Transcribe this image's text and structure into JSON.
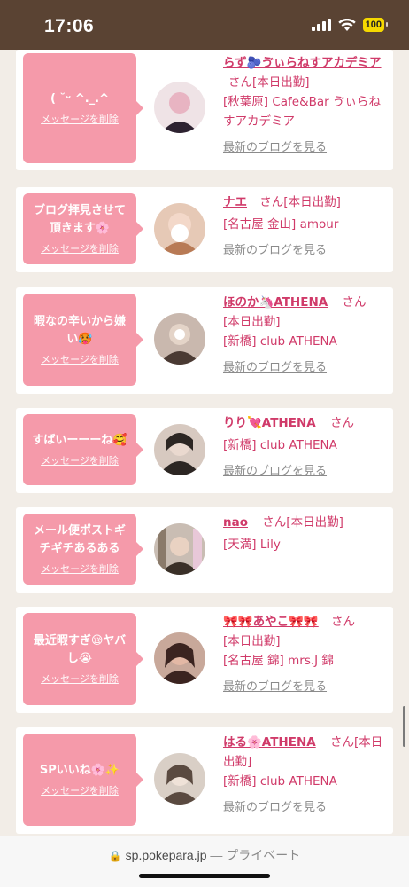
{
  "status_bar": {
    "time": "17:06",
    "battery": "100",
    "icons": [
      "signal-icon",
      "wifi-icon",
      "battery-icon"
    ]
  },
  "colors": {
    "header": "#5a4333",
    "bubble": "#f59aaa",
    "accent": "#d03a69",
    "link_gray": "#8b8b8b"
  },
  "messages": [
    {
      "bubble_text": "( ˘ᵕ ^._.^",
      "delete_label": "メッセージを削除",
      "name": "らず🫐ゔぃらねすアカデミア",
      "san": "さん",
      "today": "[本日出勤]",
      "shop": "[秋葉原] Cafe&Bar ゔぃらねすアカデミア",
      "blog_label": "最新のブログを見る",
      "avatar_colors": [
        "#e8b4c2",
        "#6b3a3a"
      ]
    },
    {
      "bubble_text": "ブログ拝見させて頂きます🌸",
      "delete_label": "メッセージを削除",
      "name": "ナエ",
      "san": "さん",
      "today": "[本日出勤]",
      "shop": "[名古屋 金山] amour",
      "blog_label": "最新のブログを見る",
      "avatar_colors": [
        "#f3d8c9",
        "#b87a55"
      ]
    },
    {
      "bubble_text": "暇なの辛いから嫌い🥵",
      "delete_label": "メッセージを削除",
      "name": "ほのか🦄ATHENA",
      "san": "さん",
      "today": "[本日出勤]",
      "shop": "[新橋] club ATHENA",
      "blog_label": "最新のブログを見る",
      "avatar_colors": [
        "#c9b8ae",
        "#4a3a33"
      ]
    },
    {
      "bubble_text": "すばいーーーね🥰",
      "delete_label": "メッセージを削除",
      "name": "りり💘ATHENA",
      "san": "さん",
      "today": "",
      "shop": "[新橋] club ATHENA",
      "blog_label": "最新のブログを見る",
      "avatar_colors": [
        "#d7c9c0",
        "#2c2623"
      ]
    },
    {
      "bubble_text": "メール便ポストギチギチあるある",
      "delete_label": "メッセージを削除",
      "name": "nao",
      "san": "さん",
      "today": "[本日出勤]",
      "shop": "[天満] Lily",
      "blog_label": "",
      "avatar_colors": [
        "#e9d2c2",
        "#3a3028"
      ]
    },
    {
      "bubble_text": "最近暇すぎ😪ヤバし😭",
      "delete_label": "メッセージを削除",
      "name": "🎀🎀あやこ🎀🎀",
      "san": "さん",
      "today": "[本日出勤]",
      "shop": "[名古屋 錦] mrs.J 錦",
      "blog_label": "最新のブログを見る",
      "avatar_colors": [
        "#e3b8a5",
        "#3b2420"
      ]
    },
    {
      "bubble_text": "SPいいね🌸✨",
      "delete_label": "メッセージを削除",
      "name": "はる🌸ATHENA",
      "san": "さん",
      "today": "[本日出勤]",
      "shop": "[新橋] club ATHENA",
      "blog_label": "最新のブログを見る",
      "avatar_colors": [
        "#d9cfc6",
        "#5a4a40"
      ]
    }
  ],
  "browser": {
    "domain": "sp.pokepara.jp",
    "separator": " — ",
    "private_label": "プライベート"
  }
}
